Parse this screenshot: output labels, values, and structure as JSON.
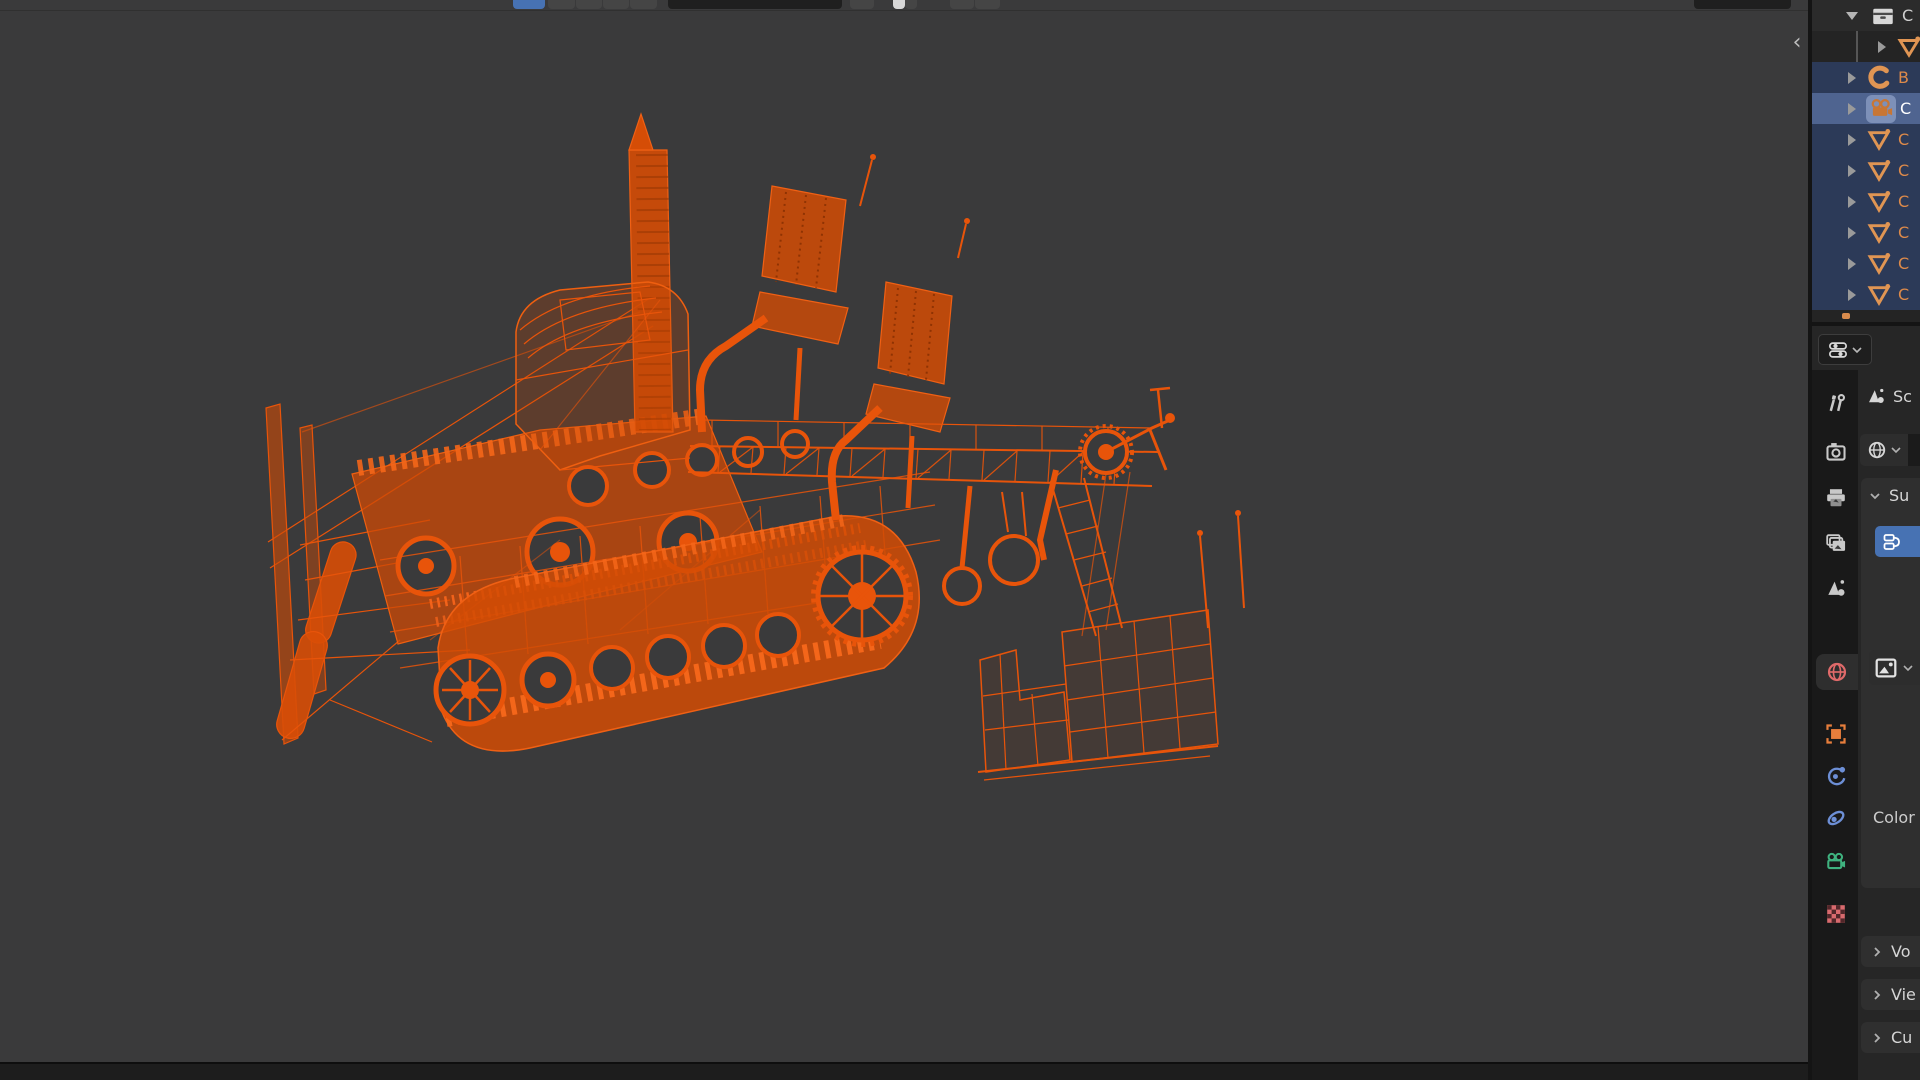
{
  "viewport": {
    "sidebar_toggle_glyph": "‹",
    "model": "orange-wireframe-tracked-harvester",
    "background_color": "#3a3a3b",
    "wireframe_color": "#e8540a",
    "header": {
      "active_tool_color": "#4772b3"
    }
  },
  "outliner": {
    "rows": [
      {
        "label": "C",
        "icon": "collection-box",
        "expanded": true,
        "selected": false
      },
      {
        "label": "",
        "icon": "mesh-triangle",
        "expanded": false,
        "selected": false,
        "child": true
      },
      {
        "label": "B",
        "icon": "curve-crescent",
        "expanded": false,
        "selected": true
      },
      {
        "label": "C",
        "icon": "camera",
        "expanded": false,
        "selected": true,
        "active": true
      },
      {
        "label": "C",
        "icon": "mesh-triangle",
        "expanded": false,
        "selected": true
      },
      {
        "label": "C",
        "icon": "mesh-triangle",
        "expanded": false,
        "selected": true
      },
      {
        "label": "C",
        "icon": "mesh-triangle",
        "expanded": false,
        "selected": true
      },
      {
        "label": "C",
        "icon": "mesh-triangle",
        "expanded": false,
        "selected": true
      },
      {
        "label": "C",
        "icon": "mesh-triangle",
        "expanded": false,
        "selected": true
      },
      {
        "label": "C",
        "icon": "mesh-triangle",
        "expanded": false,
        "selected": true
      }
    ],
    "selected_row_color": "#2c3a58",
    "active_row_color": "#4f6490",
    "selected_text_color": "#dd8a4a"
  },
  "properties_editor": {
    "type_selector_icon": "properties-sliders",
    "breadcrumb": {
      "scene_label": "Sc"
    },
    "tabs": [
      {
        "id": "tool",
        "icon": "wrench-screwdriver"
      },
      {
        "id": "render",
        "icon": "camera-back"
      },
      {
        "id": "output",
        "icon": "printer"
      },
      {
        "id": "view-layer",
        "icon": "image-stack"
      },
      {
        "id": "scene",
        "icon": "cone-spheres"
      },
      {
        "id": "world",
        "icon": "globe",
        "active": true,
        "color": "#e06a6a"
      },
      {
        "id": "object",
        "icon": "orange-square",
        "color": "#e77e3c"
      },
      {
        "id": "physics",
        "icon": "orbit",
        "color": "#6d8fd6"
      },
      {
        "id": "constraints",
        "icon": "clamp",
        "color": "#6d8fd6"
      },
      {
        "id": "object-data",
        "icon": "green-camera",
        "color": "#3fb27f"
      },
      {
        "id": "texture",
        "icon": "checkerboard",
        "color": "#d86a6e"
      }
    ],
    "world_section": {
      "id_browser_icon": "globe",
      "surface_panel_label": "Su",
      "use_nodes_button_color": "#4772b3",
      "use_nodes_icon": "nodes",
      "image_selector_icon": "image",
      "color_row_label": "Color"
    },
    "collapsed_panels": [
      {
        "label": "Vo"
      },
      {
        "label": "Vie"
      },
      {
        "label": "Cu"
      }
    ]
  }
}
